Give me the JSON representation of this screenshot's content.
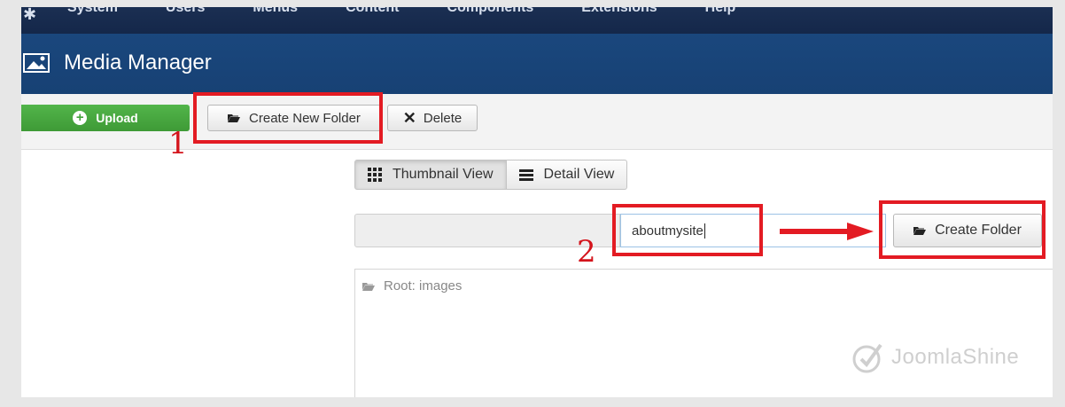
{
  "topnav": {
    "items": [
      "System",
      "Users",
      "Menus",
      "Content",
      "Components",
      "Extensions",
      "Help"
    ]
  },
  "header": {
    "title": "Media Manager"
  },
  "toolbar": {
    "upload_label": "Upload",
    "create_new_folder_label": "Create New Folder",
    "delete_label": "Delete"
  },
  "views": {
    "thumbnail_label": "Thumbnail View",
    "detail_label": "Detail View",
    "active": "thumbnail"
  },
  "folder_form": {
    "path_value": "",
    "folder_name_value": "aboutmysite",
    "create_label": "Create Folder"
  },
  "browser": {
    "root_label": "Root: images"
  },
  "annotations": {
    "step1": "1",
    "step2": "2",
    "color": "#e31b23"
  },
  "watermark": {
    "text": "JoomlaShine"
  },
  "colors": {
    "header_bg": "#174174",
    "nav_bg": "#14274a",
    "upload_green": "#46a73e"
  }
}
